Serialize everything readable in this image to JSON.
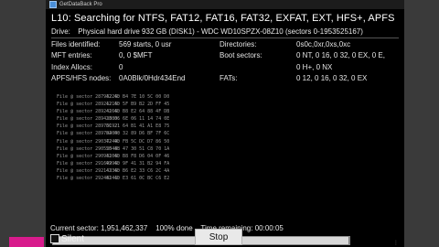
{
  "window": {
    "title": "GetDataBack Pro"
  },
  "heading": "L10: Searching for NTFS, FAT12, FAT16, FAT32, EXFAT, EXT, HFS+, APFS",
  "drive": {
    "label": "Drive:",
    "value": "Physical hard drive 932 GB (DISK1) - WDC WD10SPZX-08Z10 (sectors 0-1953525167)"
  },
  "left_stats": [
    {
      "label": "Files identified:",
      "value": "569 starts, 0 usr"
    },
    {
      "label": "MFT entries:",
      "value": "0, 0 $MFT"
    },
    {
      "label": "Index Allocs:",
      "value": "0"
    },
    {
      "label": "APFS/HFS nodes:",
      "value": "0A0Blk/0Hdr434End"
    }
  ],
  "right_stats": [
    {
      "label": "Directories:",
      "value": "0s0c,0xr,0xs,0xc"
    },
    {
      "label": "Boot sectors:",
      "value": "0 NT, 0 16, 0 32, 0 EX, 0 E,"
    },
    {
      "label": "",
      "value": "0 H+, 0 NX"
    },
    {
      "label": "FATs:",
      "value": "0 12, 0 16, 0 32, 0 EX"
    }
  ],
  "log": [
    {
      "file": "File @ sector 28793226:",
      "bytes": "42 4D B4 7E 10 5C 00 D0"
    },
    {
      "file": "File @ sector 28921215:",
      "bytes": "42 4D 5F B9 B2 2D FF 45"
    },
    {
      "file": "File @ sector 28924166:",
      "bytes": "42 4D B8 E2 64 88 4F DB"
    },
    {
      "file": "File @ sector 28943080:",
      "bytes": "23 06 6E 06 11 14 74 0E"
    },
    {
      "file": "File @ sector 28976192:",
      "bytes": "3C 21 64 B1 41 A1 E8 75"
    },
    {
      "file": "File @ sector 28979404:",
      "bytes": "82 00 32 89 D6 BF 7F 6C"
    },
    {
      "file": "File @ sector 29037249:",
      "bytes": "42 4D FB 5C DC D7 86 50"
    },
    {
      "file": "File @ sector 29052548:",
      "bytes": "50 4B 47 30 51 C8 70 1A"
    },
    {
      "file": "File @ sector 29093106:",
      "bytes": "42 4D B8 F8 D6 04 0F 46"
    },
    {
      "file": "File @ sector 29169996:",
      "bytes": "42 4D 9F 41 31 B2 94 FA"
    },
    {
      "file": "File @ sector 29214336:",
      "bytes": "42 4D B6 E2 33 C6 2C 4A"
    },
    {
      "file": "File @ sector 29248141:",
      "bytes": "42 4D E3 61 0C BC C6 E2"
    }
  ],
  "status": {
    "current_sector": "Current sector: 1,951,462,337",
    "done": "100% done",
    "remaining": "Time remaining: 00:00:05"
  },
  "progress": {
    "fraction": 0.998
  },
  "silent_label": "Silent",
  "stop_label": "Stop",
  "side_badge_label": "",
  "colors": {
    "background": "#000000",
    "badge": "#d81b8c"
  }
}
